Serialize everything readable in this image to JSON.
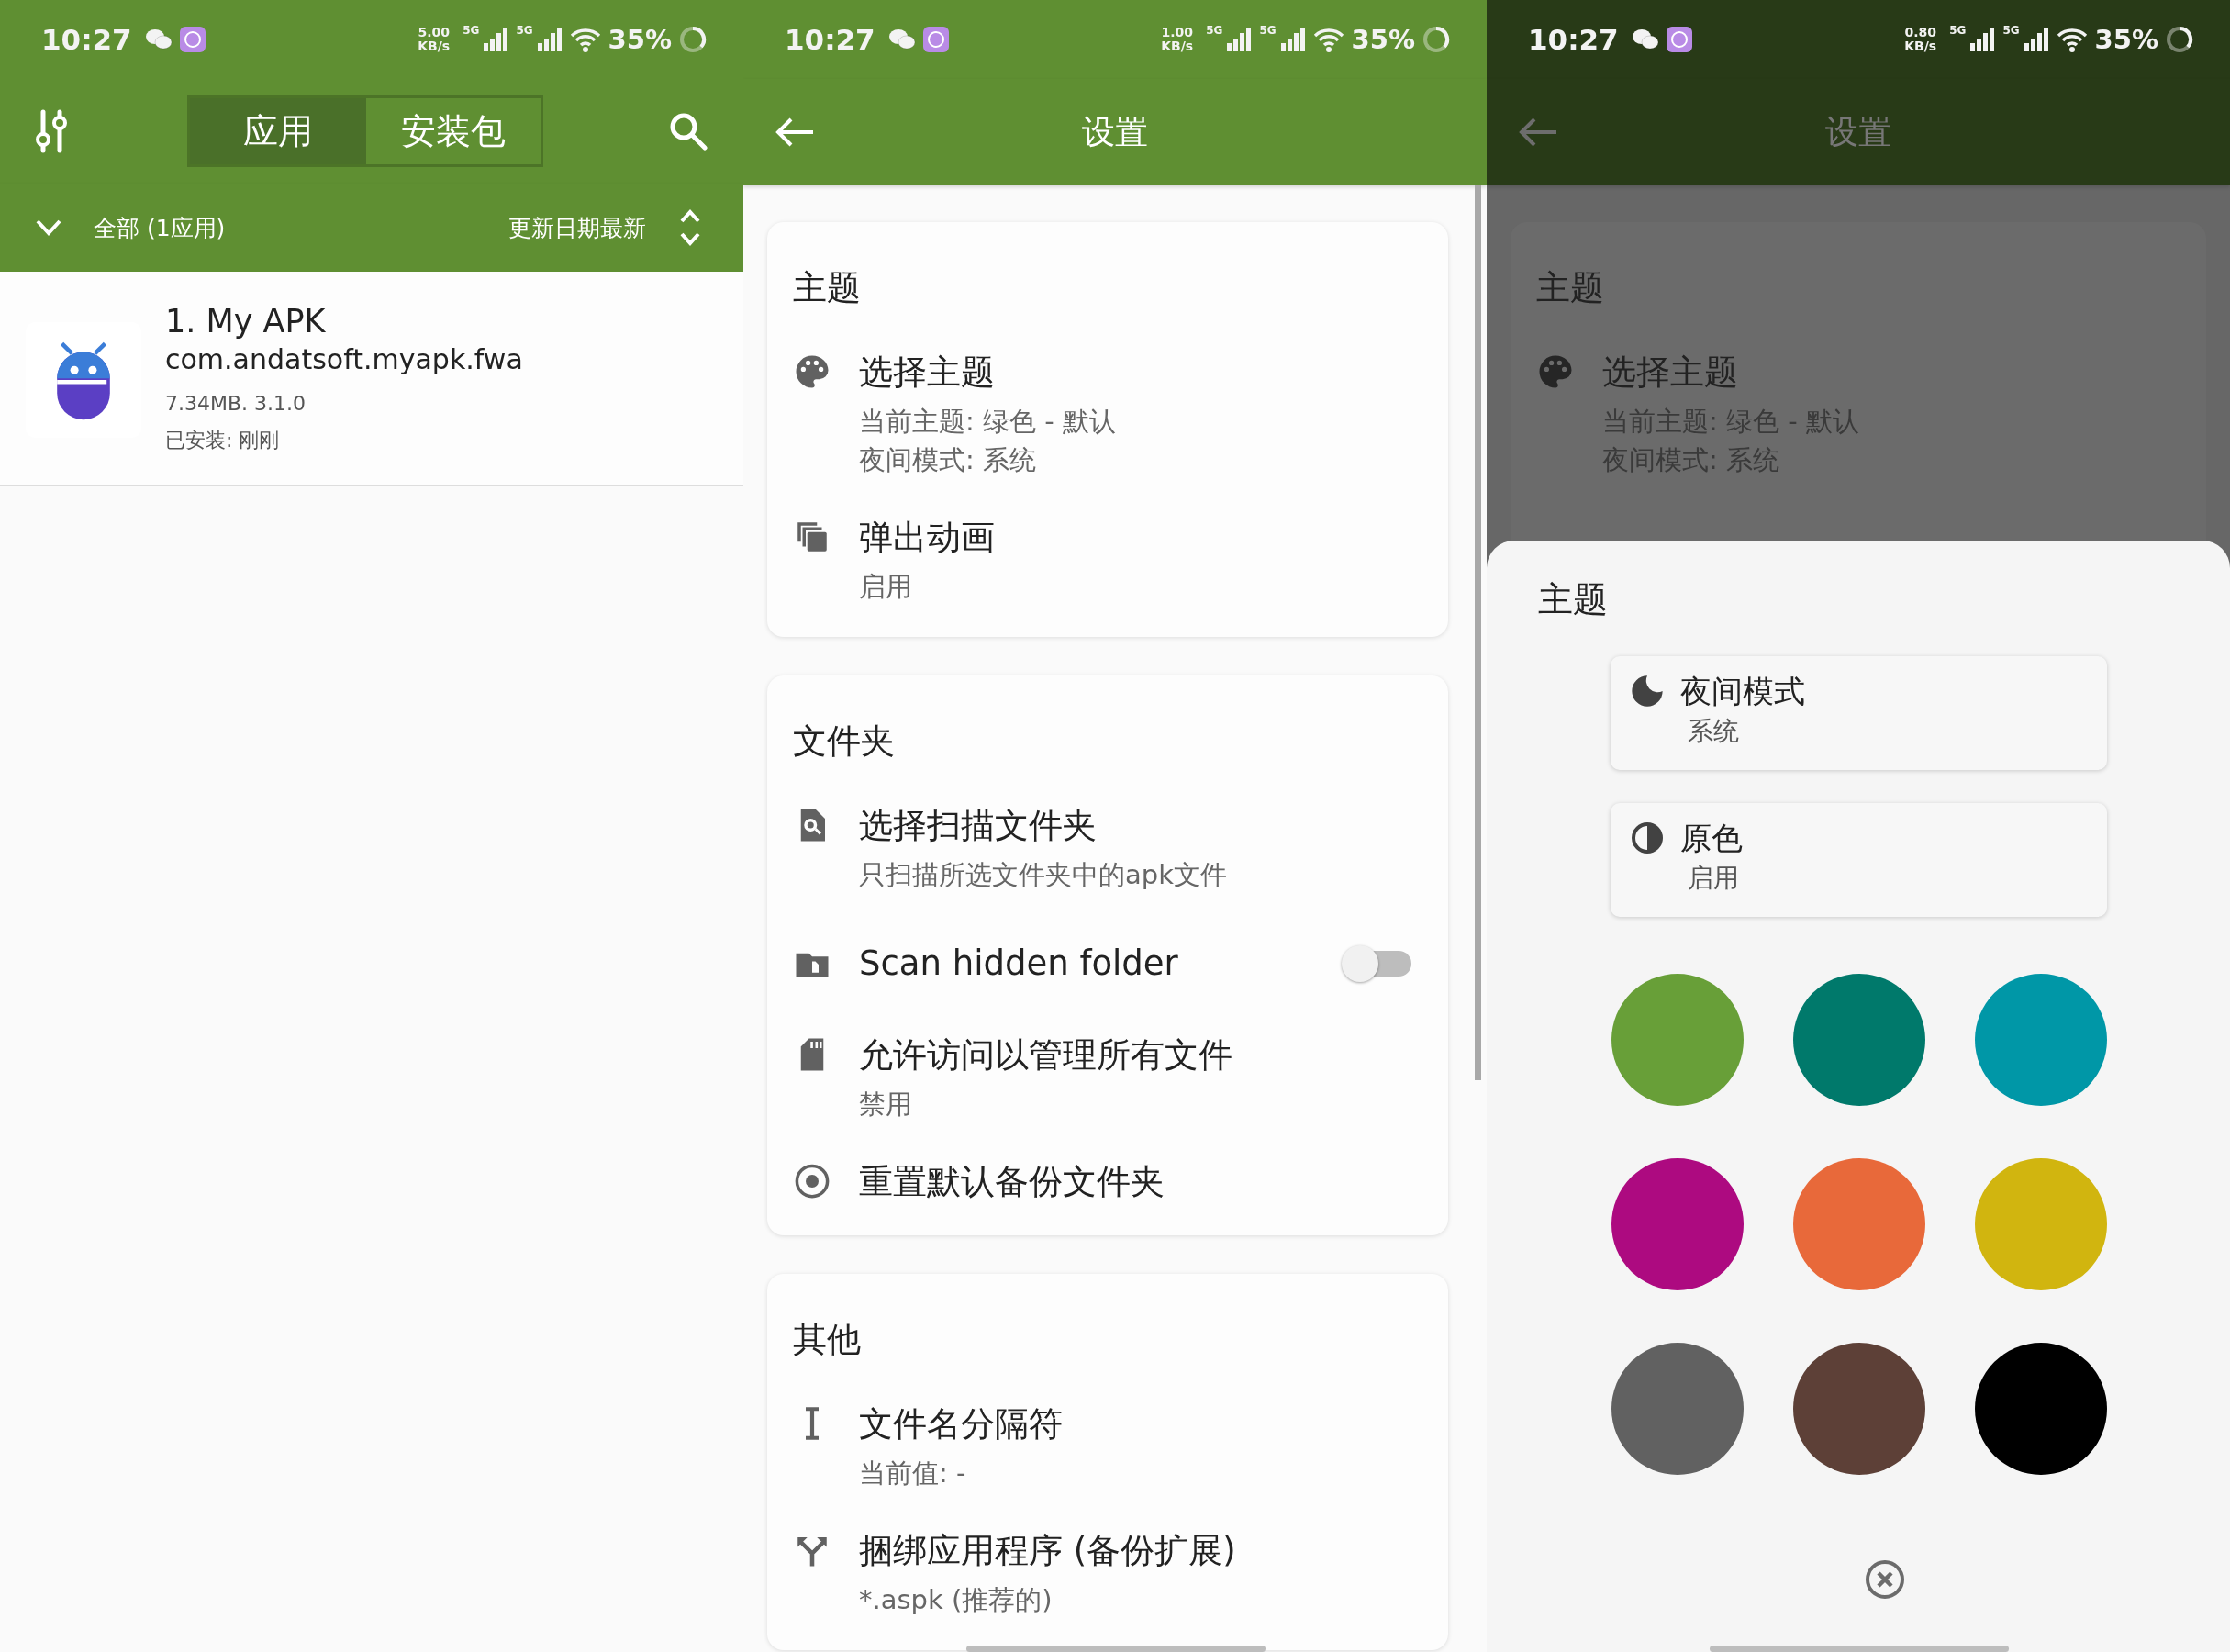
{
  "screens": [
    {
      "kind": "app_list",
      "status_bar": {
        "time": "10:27",
        "speed_value": "5.00",
        "speed_unit": "KB/s",
        "sim_1": "5G",
        "sim_2": "5G",
        "battery": "35%"
      },
      "tabs": [
        {
          "label": "应用",
          "selected": true
        },
        {
          "label": "安装包",
          "selected": false
        }
      ],
      "filter": {
        "label": "全部 (1应用)",
        "sort": "更新日期最新"
      },
      "apps": [
        {
          "name": "1. My APK",
          "package": "com.andatsoft.myapk.fwa",
          "size_version": "7.34MB. 3.1.0",
          "installed": "已安装: 刚刚"
        }
      ]
    },
    {
      "kind": "settings",
      "status_bar": {
        "time": "10:27",
        "speed_value": "1.00",
        "speed_unit": "KB/s",
        "sim_1": "5G",
        "sim_2": "5G",
        "battery": "35%"
      },
      "title": "设置",
      "sections": [
        {
          "title": "主题",
          "items": [
            {
              "kind": "text",
              "title": "选择主题",
              "subtitles": [
                "当前主题: 绿色 - 默认",
                "夜间模式: 系统"
              ]
            },
            {
              "kind": "text",
              "title": "弹出动画",
              "subtitles": [
                "启用"
              ]
            }
          ]
        },
        {
          "title": "文件夹",
          "items": [
            {
              "kind": "text",
              "title": "选择扫描文件夹",
              "subtitles": [
                "只扫描所选文件夹中的apk文件"
              ]
            },
            {
              "kind": "switch",
              "title": "Scan hidden folder",
              "on": false
            },
            {
              "kind": "text",
              "title": "允许访问以管理所有文件",
              "subtitles": [
                "禁用"
              ]
            },
            {
              "kind": "text",
              "title": "重置默认备份文件夹"
            }
          ]
        },
        {
          "title": "其他",
          "items": [
            {
              "kind": "text",
              "title": "文件名分隔符",
              "subtitles": [
                "当前值: -"
              ]
            },
            {
              "kind": "text",
              "title": "捆绑应用程序 (备份扩展)",
              "subtitles": [
                "*.aspk (推荐的)"
              ]
            }
          ]
        }
      ]
    },
    {
      "kind": "settings_dimmed",
      "status_bar": {
        "time": "10:27",
        "speed_value": "0.80",
        "speed_unit": "KB/s",
        "sim_1": "5G",
        "sim_2": "5G",
        "battery": "35%"
      },
      "title": "设置",
      "section": {
        "title": "主题",
        "items": [
          {
            "title": "选择主题",
            "subtitles": [
              "当前主题: 绿色 - 默认",
              "夜间模式: 系统"
            ]
          }
        ]
      },
      "sheet": {
        "title": "主题",
        "options": [
          {
            "title": "夜间模式",
            "value": "系统"
          },
          {
            "title": "原色",
            "value": "启用"
          }
        ],
        "colors": [
          {
            "color": "#689f38"
          },
          {
            "color": "#00796b"
          },
          {
            "color": "#0097a7"
          },
          {
            "color": "#ad0a80"
          },
          {
            "color": "#e8693a"
          },
          {
            "color": "#d1b50f"
          },
          {
            "color": "#616161"
          },
          {
            "color": "#5d4037"
          },
          {
            "color": "#000000"
          }
        ]
      }
    }
  ]
}
